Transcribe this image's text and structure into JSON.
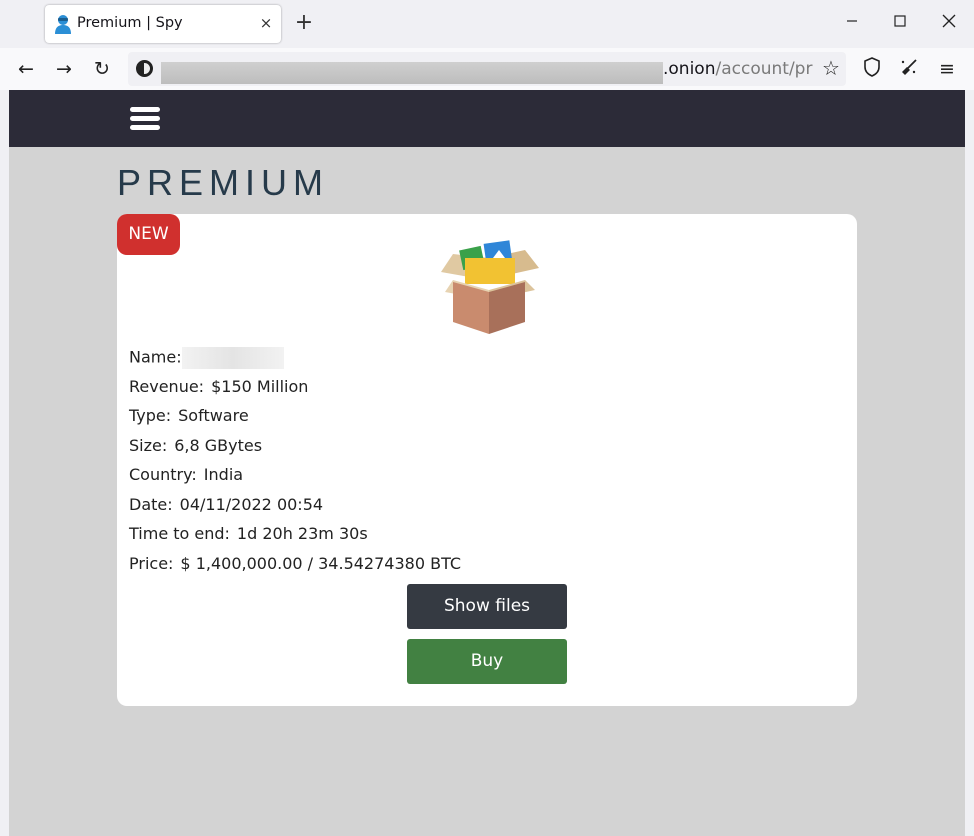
{
  "browser": {
    "tab_title": "Premium | Spy",
    "tab_close": "×",
    "new_tab": "+",
    "window_controls": {
      "minimize": "—",
      "maximize": "☐",
      "close": "✕"
    },
    "nav": {
      "back": "←",
      "forward": "→",
      "reload": "↻",
      "menu": "≡"
    },
    "url_visible": ".onion/account/pre",
    "url_prefix_hidden": "",
    "bookmark_star": "☆"
  },
  "site": {
    "heading": "PREMIUM",
    "badge": "NEW",
    "fields": [
      {
        "label": "Name:",
        "value": ""
      },
      {
        "label": "Revenue:",
        "value": "$150 Million"
      },
      {
        "label": "Type:",
        "value": "Software"
      },
      {
        "label": "Size:",
        "value": "6,8 GBytes"
      },
      {
        "label": "Country:",
        "value": "India"
      },
      {
        "label": "Date:",
        "value": "04/11/2022 00:54"
      },
      {
        "label": "Time to end:",
        "value": "1d 20h 23m 30s"
      },
      {
        "label": "Price:",
        "value": "$ 1,400,000.00 / 34.54274380 BTC"
      }
    ],
    "show_files_label": "Show files",
    "buy_label": "Buy"
  },
  "colors": {
    "header_bg": "#2c2b38",
    "page_bg": "#d3d3d3",
    "badge": "#d0302e",
    "show_files": "#353a42",
    "buy": "#428142"
  }
}
